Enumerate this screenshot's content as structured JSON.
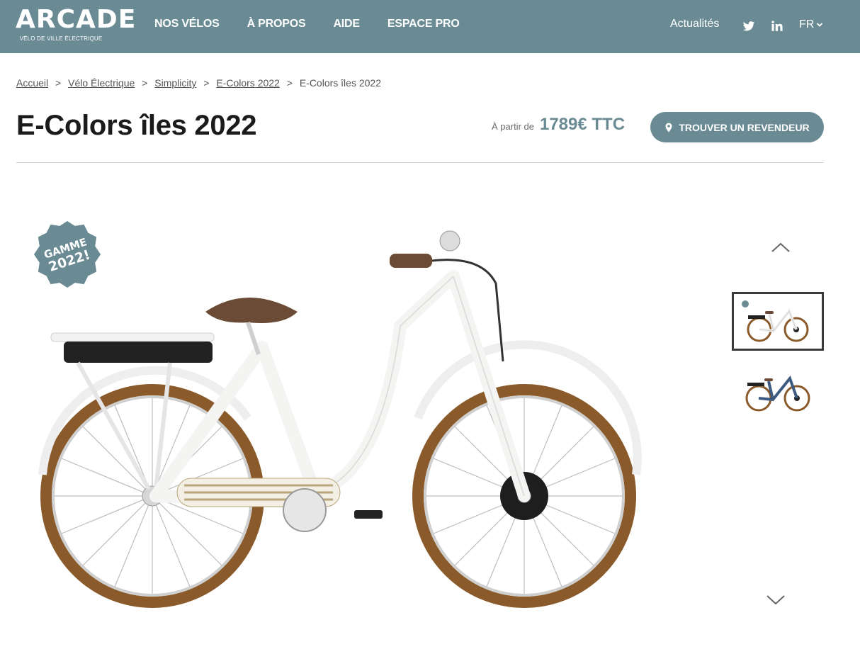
{
  "header": {
    "logo": {
      "word": "ARCADE",
      "tagline": "VÉLO DE VILLE ÉLECTRIQUE"
    },
    "nav": [
      "NOS VÉLOS",
      "À PROPOS",
      "AIDE",
      "ESPACE PRO"
    ],
    "news_label": "Actualités",
    "social_icons": [
      "twitter-icon",
      "linkedin-icon"
    ],
    "language": "FR"
  },
  "breadcrumb": {
    "items": [
      "Accueil",
      "Vélo Électrique",
      "Simplicity",
      "E-Colors 2022"
    ],
    "current": "E-Colors îles 2022",
    "separator": ">"
  },
  "product": {
    "title": "E-Colors îles 2022",
    "price_prefix": "À partir de",
    "price": "1789€ TTC",
    "dealer_button": "TROUVER UN REVENDEUR",
    "badge": {
      "line1": "GAMME",
      "line2": "2022!"
    }
  },
  "gallery": {
    "thumbnails": [
      "white-bike-thumbnail",
      "blue-bike-thumbnail"
    ],
    "selected_index": 0
  },
  "colors": {
    "brand": "#6a8b94",
    "text": "#1b1b1b",
    "tire": "#8a5a2b",
    "frame_white": "#f4f4f2",
    "frame_blue": "#3d5a80"
  }
}
